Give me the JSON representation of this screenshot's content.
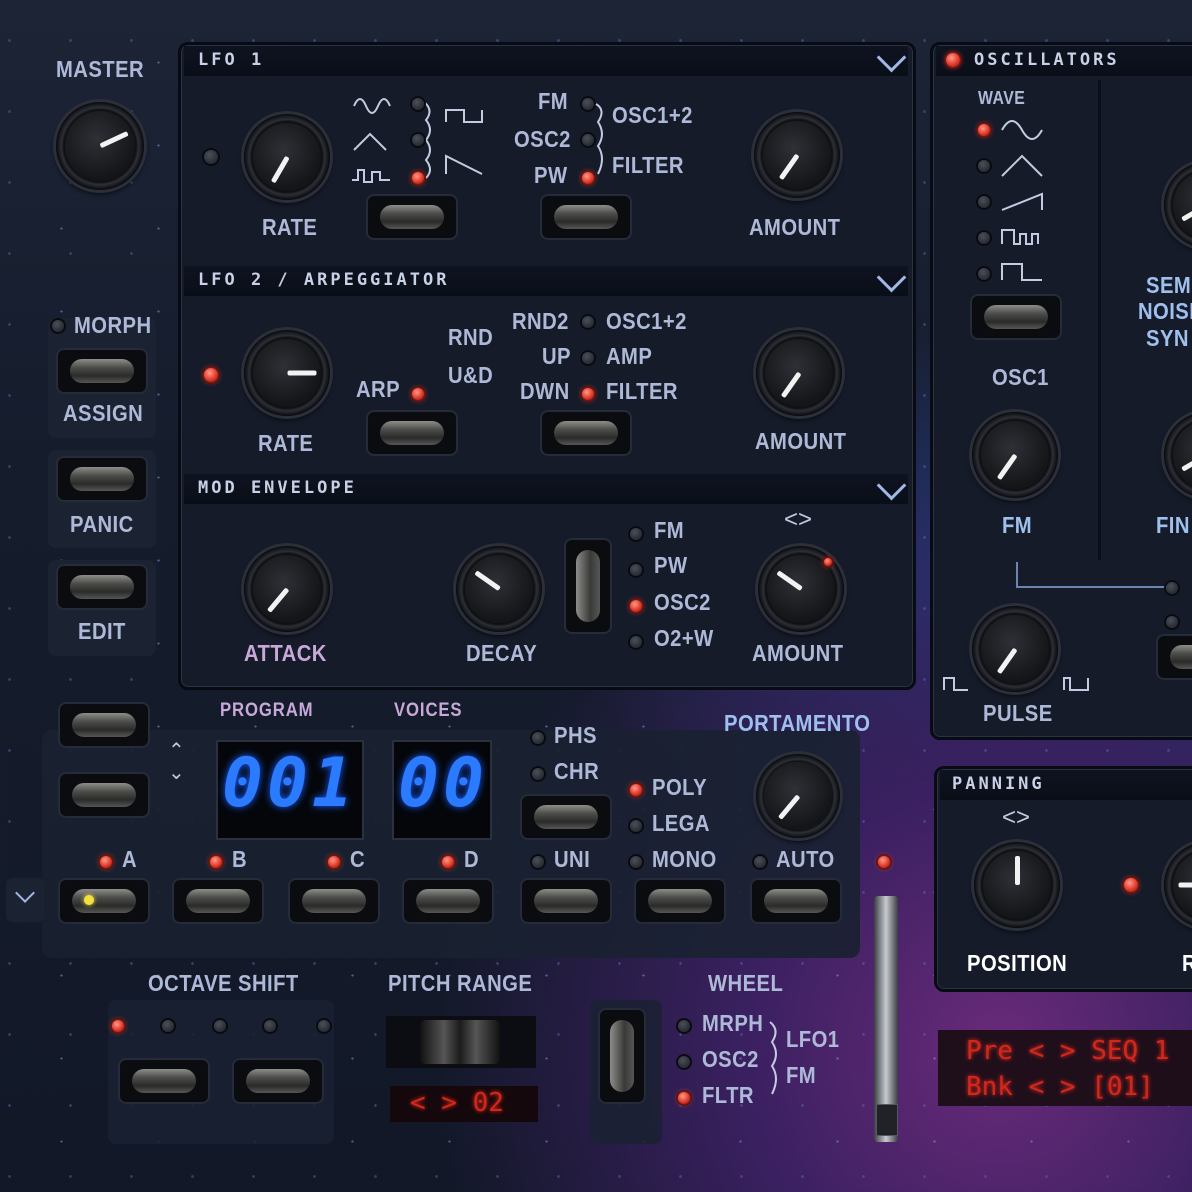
{
  "master": {
    "label": "MASTER"
  },
  "left": {
    "morph": "MORPH",
    "assign": "ASSIGN",
    "panic": "PANIC",
    "edit": "EDIT"
  },
  "lfo1": {
    "title": "LFO 1",
    "rate": "RATE",
    "amount": "AMOUNT",
    "dest_fm": "FM",
    "dest_osc2": "OSC2",
    "dest_pw": "PW",
    "target_osc12": "OSC1+2",
    "target_filter": "FILTER"
  },
  "lfo2": {
    "title": "LFO 2 / ARPEGGIATOR",
    "rate": "RATE",
    "arp": "ARP",
    "amount": "AMOUNT",
    "rnd": "RND",
    "ud": "U&D",
    "rnd2": "RND2",
    "up": "UP",
    "dwn": "DWN",
    "target_osc12": "OSC1+2",
    "target_amp": "AMP",
    "target_filter": "FILTER"
  },
  "modenv": {
    "title": "MOD ENVELOPE",
    "attack": "ATTACK",
    "decay": "DECAY",
    "amount": "AMOUNT",
    "dest_fm": "FM",
    "dest_pw": "PW",
    "dest_osc2": "OSC2",
    "dest_o2w": "O2+W"
  },
  "osc": {
    "title": "OSCILLATORS",
    "wave": "WAVE",
    "osc1": "OSC1",
    "fm": "FM",
    "pulse": "PULSE",
    "semi_1": "SEM",
    "semi_2": "NOISI",
    "semi_3": "SYN",
    "fine": "FIN"
  },
  "program": {
    "label": "PROGRAM",
    "value": "001"
  },
  "voices": {
    "label": "VOICES",
    "value": "00"
  },
  "mode": {
    "phs": "PHS",
    "chr": "CHR",
    "uni": "UNI",
    "poly": "POLY",
    "lega": "LEGA",
    "mono": "MONO"
  },
  "portamento": {
    "label": "PORTAMENTO",
    "auto": "AUTO"
  },
  "banks": {
    "a": "A",
    "b": "B",
    "c": "C",
    "d": "D"
  },
  "octave": {
    "label": "OCTAVE SHIFT"
  },
  "pitch": {
    "label": "PITCH RANGE",
    "value": "< > 02"
  },
  "wheel": {
    "label": "WHEEL",
    "mrph": "MRPH",
    "osc2": "OSC2",
    "fltr": "FLTR",
    "lfo1": "LFO1",
    "fm": "FM"
  },
  "panning": {
    "title": "PANNING",
    "position": "POSITION",
    "r": "R"
  },
  "display": {
    "line1": "Pre < > SEQ 1",
    "line2": "Bnk < > [01]"
  }
}
